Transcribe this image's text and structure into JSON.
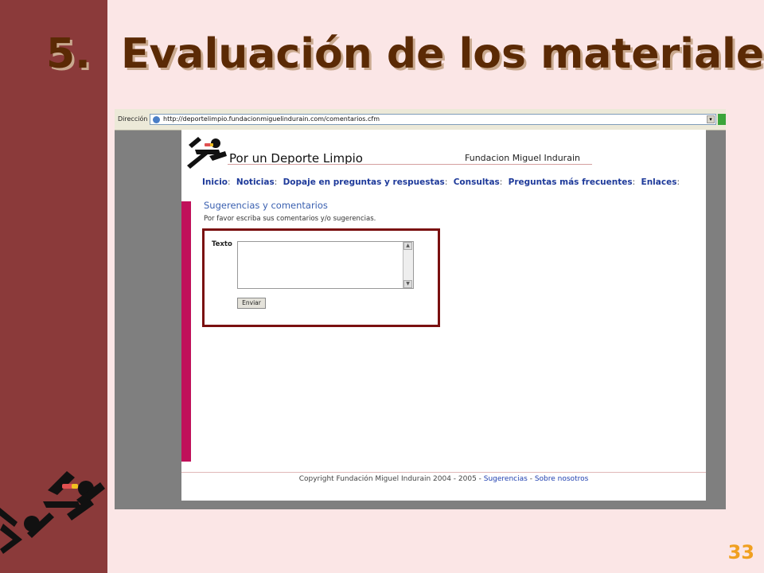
{
  "slide": {
    "number": "5.",
    "title": "Evaluación de los materiales",
    "page": "33"
  },
  "browser": {
    "address_label": "Dirección",
    "url": "http://deportelimpio.fundacionmiguelindurain.com/comentarios.cfm"
  },
  "site": {
    "name": "Por un Deporte Limpio",
    "org": "Fundacion Miguel Indurain",
    "nav": [
      {
        "label": "Inicio"
      },
      {
        "label": "Noticias"
      },
      {
        "label": "Dopaje en preguntas y respuestas"
      },
      {
        "label": "Consultas"
      },
      {
        "label": "Preguntas más frecuentes"
      },
      {
        "label": "Enlaces"
      }
    ],
    "nav_separator": ":"
  },
  "form": {
    "section_title": "Sugerencias y comentarios",
    "description": "Por favor escriba sus comentarios y/o sugerencias.",
    "text_label": "Texto",
    "text_value": "",
    "submit_label": "Enviar"
  },
  "footer": {
    "copyright": "Copyright Fundación Miguel Indurain 2004 - 2005 - ",
    "link1": "Sugerencias",
    "dash": " - ",
    "link2": "Sobre nosotros"
  },
  "colors": {
    "left_band": "#8b3a3a",
    "background": "#fbe6e6",
    "title": "#5b2a05",
    "page_number": "#f0a020",
    "highlight": "#7a1010",
    "side_bar": "#c0105a",
    "nav_link": "#1e3a9a"
  },
  "icons": [
    "runner-logo-icon",
    "ie-page-icon",
    "go-arrow-icon"
  ]
}
